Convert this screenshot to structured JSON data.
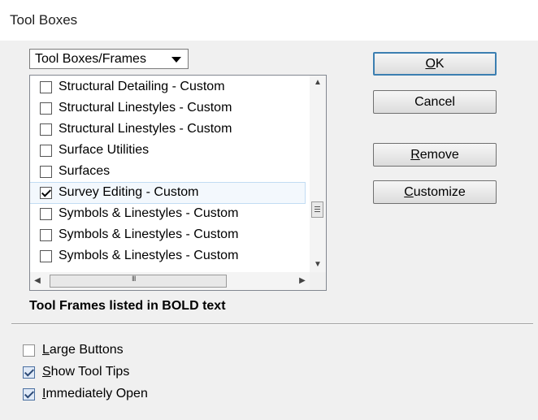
{
  "window": {
    "title": "Tool Boxes"
  },
  "filter": {
    "selected": "Tool Boxes/Frames"
  },
  "list": {
    "items": [
      {
        "label": "Structural Detailing - Custom",
        "checked": false
      },
      {
        "label": "Structural Linestyles - Custom",
        "checked": false
      },
      {
        "label": "Structural Linestyles - Custom",
        "checked": false
      },
      {
        "label": "Surface Utilities",
        "checked": false
      },
      {
        "label": "Surfaces",
        "checked": false
      },
      {
        "label": "Survey Editing - Custom",
        "checked": true,
        "selected": true
      },
      {
        "label": "Symbols & Linestyles - Custom",
        "checked": false
      },
      {
        "label": "Symbols & Linestyles - Custom",
        "checked": false
      },
      {
        "label": "Symbols & Linestyles - Custom",
        "checked": false
      }
    ]
  },
  "note": "Tool Frames listed in BOLD text",
  "buttons": {
    "ok": {
      "underline": "O",
      "rest": "K"
    },
    "cancel": "Cancel",
    "remove": {
      "underline": "R",
      "rest": "emove"
    },
    "customize": {
      "underline": "C",
      "rest": "ustomize"
    }
  },
  "options": {
    "large_buttons": {
      "underline": "L",
      "rest": "arge Buttons",
      "checked": false
    },
    "show_tool_tips": {
      "underline": "S",
      "rest": "how Tool Tips",
      "checked": true
    },
    "immediately_open": {
      "underline": "I",
      "rest": "mmediately Open",
      "checked": true
    }
  }
}
